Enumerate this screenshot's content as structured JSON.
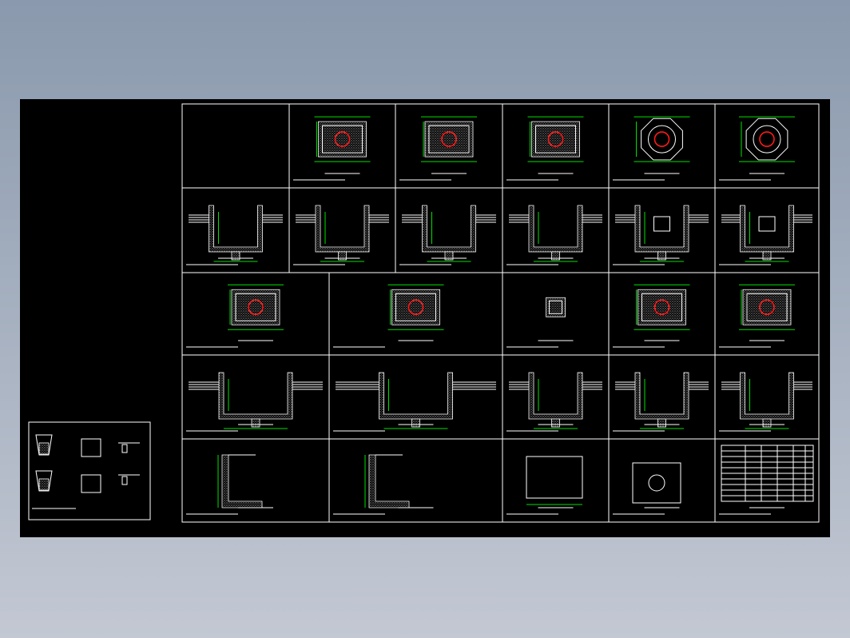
{
  "window": {
    "background_gradient": [
      "#8a99ad",
      "#c3c8d3"
    ],
    "canvas_color": "#000000"
  },
  "colors": {
    "frame": "#ffffff",
    "dimension": "#00e000",
    "pipe_circle": "#ff1a1a",
    "note_text": "#ff33ff"
  },
  "drawing": {
    "footer_note": "",
    "sheet_count_rows": 5
  }
}
